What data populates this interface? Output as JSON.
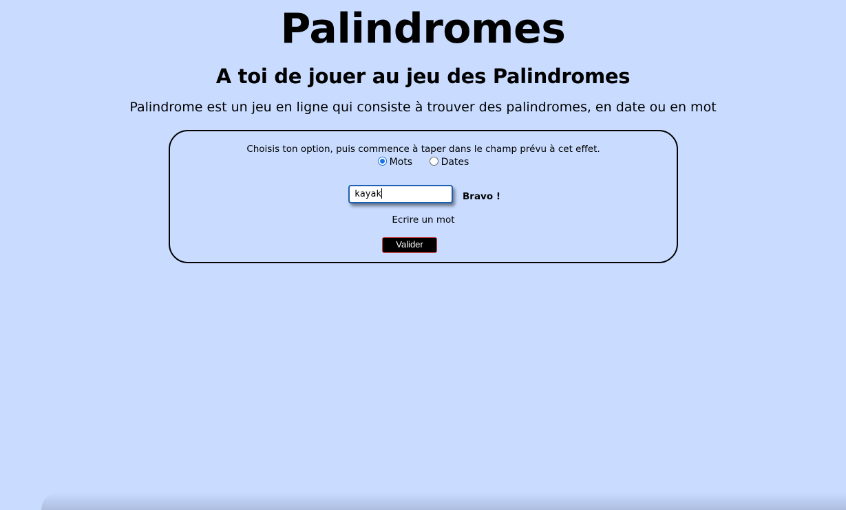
{
  "header": {
    "title": "Palindromes",
    "subtitle": "A toi de jouer au jeu des Palindromes",
    "intro": "Palindrome est un jeu en ligne qui consiste à trouver des palindromes, en date ou en mot"
  },
  "game": {
    "instructions": "Choisis ton option, puis commence à taper dans le champ prévu à cet effet.",
    "options": [
      {
        "label": "Mots",
        "checked": true
      },
      {
        "label": "Dates",
        "checked": false
      }
    ],
    "input": {
      "value": "kayak"
    },
    "feedback": "Bravo !",
    "hint": "Ecrire un mot",
    "submit_label": "Valider"
  },
  "colors": {
    "background": "#c9dcff",
    "radio_accent": "#1a73e8",
    "input_border": "#1f5fb4",
    "button_bg": "#000000"
  }
}
